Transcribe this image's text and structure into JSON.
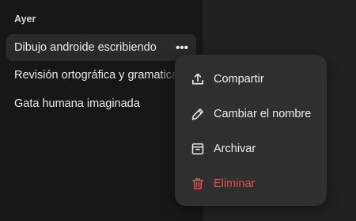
{
  "sidebar": {
    "section_title": "Ayer",
    "chats": [
      {
        "label": "Dibujo androide escribiendo"
      },
      {
        "label": "Revisión ortográfica y gramatical"
      },
      {
        "label": "Gata humana imaginada"
      }
    ],
    "more_button_label": "•••"
  },
  "context_menu": {
    "items": [
      {
        "label": "Compartir",
        "icon": "share-icon"
      },
      {
        "label": "Cambiar el nombre",
        "icon": "pencil-icon"
      },
      {
        "label": "Archivar",
        "icon": "archive-icon"
      },
      {
        "label": "Eliminar",
        "icon": "trash-icon"
      }
    ]
  },
  "colors": {
    "sidebar_bg": "#171717",
    "main_bg": "#212121",
    "menu_bg": "#2f2f2f",
    "danger": "#e0524e"
  }
}
